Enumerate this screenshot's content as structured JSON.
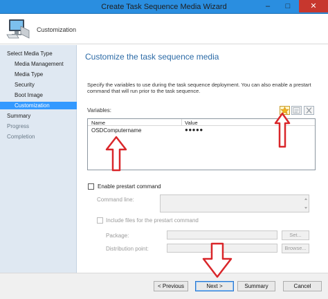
{
  "window": {
    "title": "Create Task Sequence Media Wizard",
    "minimize_glyph": "–",
    "maximize_glyph": "□",
    "close_glyph": "✕"
  },
  "header": {
    "title": "Customization",
    "icon": "computer-icon"
  },
  "sidebar": {
    "items": [
      {
        "label": "Select Media Type",
        "level": 0,
        "state": "normal"
      },
      {
        "label": "Media Management",
        "level": 1,
        "state": "normal"
      },
      {
        "label": "Media Type",
        "level": 1,
        "state": "normal"
      },
      {
        "label": "Security",
        "level": 1,
        "state": "normal"
      },
      {
        "label": "Boot Image",
        "level": 1,
        "state": "normal"
      },
      {
        "label": "Customization",
        "level": 1,
        "state": "active"
      },
      {
        "label": "Summary",
        "level": 0,
        "state": "normal"
      },
      {
        "label": "Progress",
        "level": 0,
        "state": "dim"
      },
      {
        "label": "Completion",
        "level": 0,
        "state": "dim"
      }
    ]
  },
  "content": {
    "title": "Customize the task sequence media",
    "description": "Specify the variables to use during the task sequence deployment. You can also enable a prestart command that will run prior to the task sequence.",
    "variables_label": "Variables:",
    "toolbar_icons": [
      "new-star-icon",
      "properties-icon",
      "delete-x-icon"
    ],
    "table": {
      "columns": [
        "Name",
        "Value"
      ],
      "rows": [
        {
          "name": "OSDComputername",
          "value": "●●●●●"
        }
      ]
    },
    "prestart": {
      "enable_label": "Enable prestart command",
      "enabled": false,
      "command_line_label": "Command line:",
      "command_line_value": "",
      "include_files_label": "Include files for the prestart command",
      "include_files_checked": false,
      "package_label": "Package:",
      "package_value": "",
      "set_button": "Set...",
      "distribution_point_label": "Distribution point:",
      "distribution_point_value": "",
      "browse_button": "Browse..."
    }
  },
  "footer": {
    "previous": "< Previous",
    "next": "Next >",
    "summary": "Summary",
    "cancel": "Cancel"
  },
  "annotations": {
    "arrow_color": "#d9262a"
  }
}
